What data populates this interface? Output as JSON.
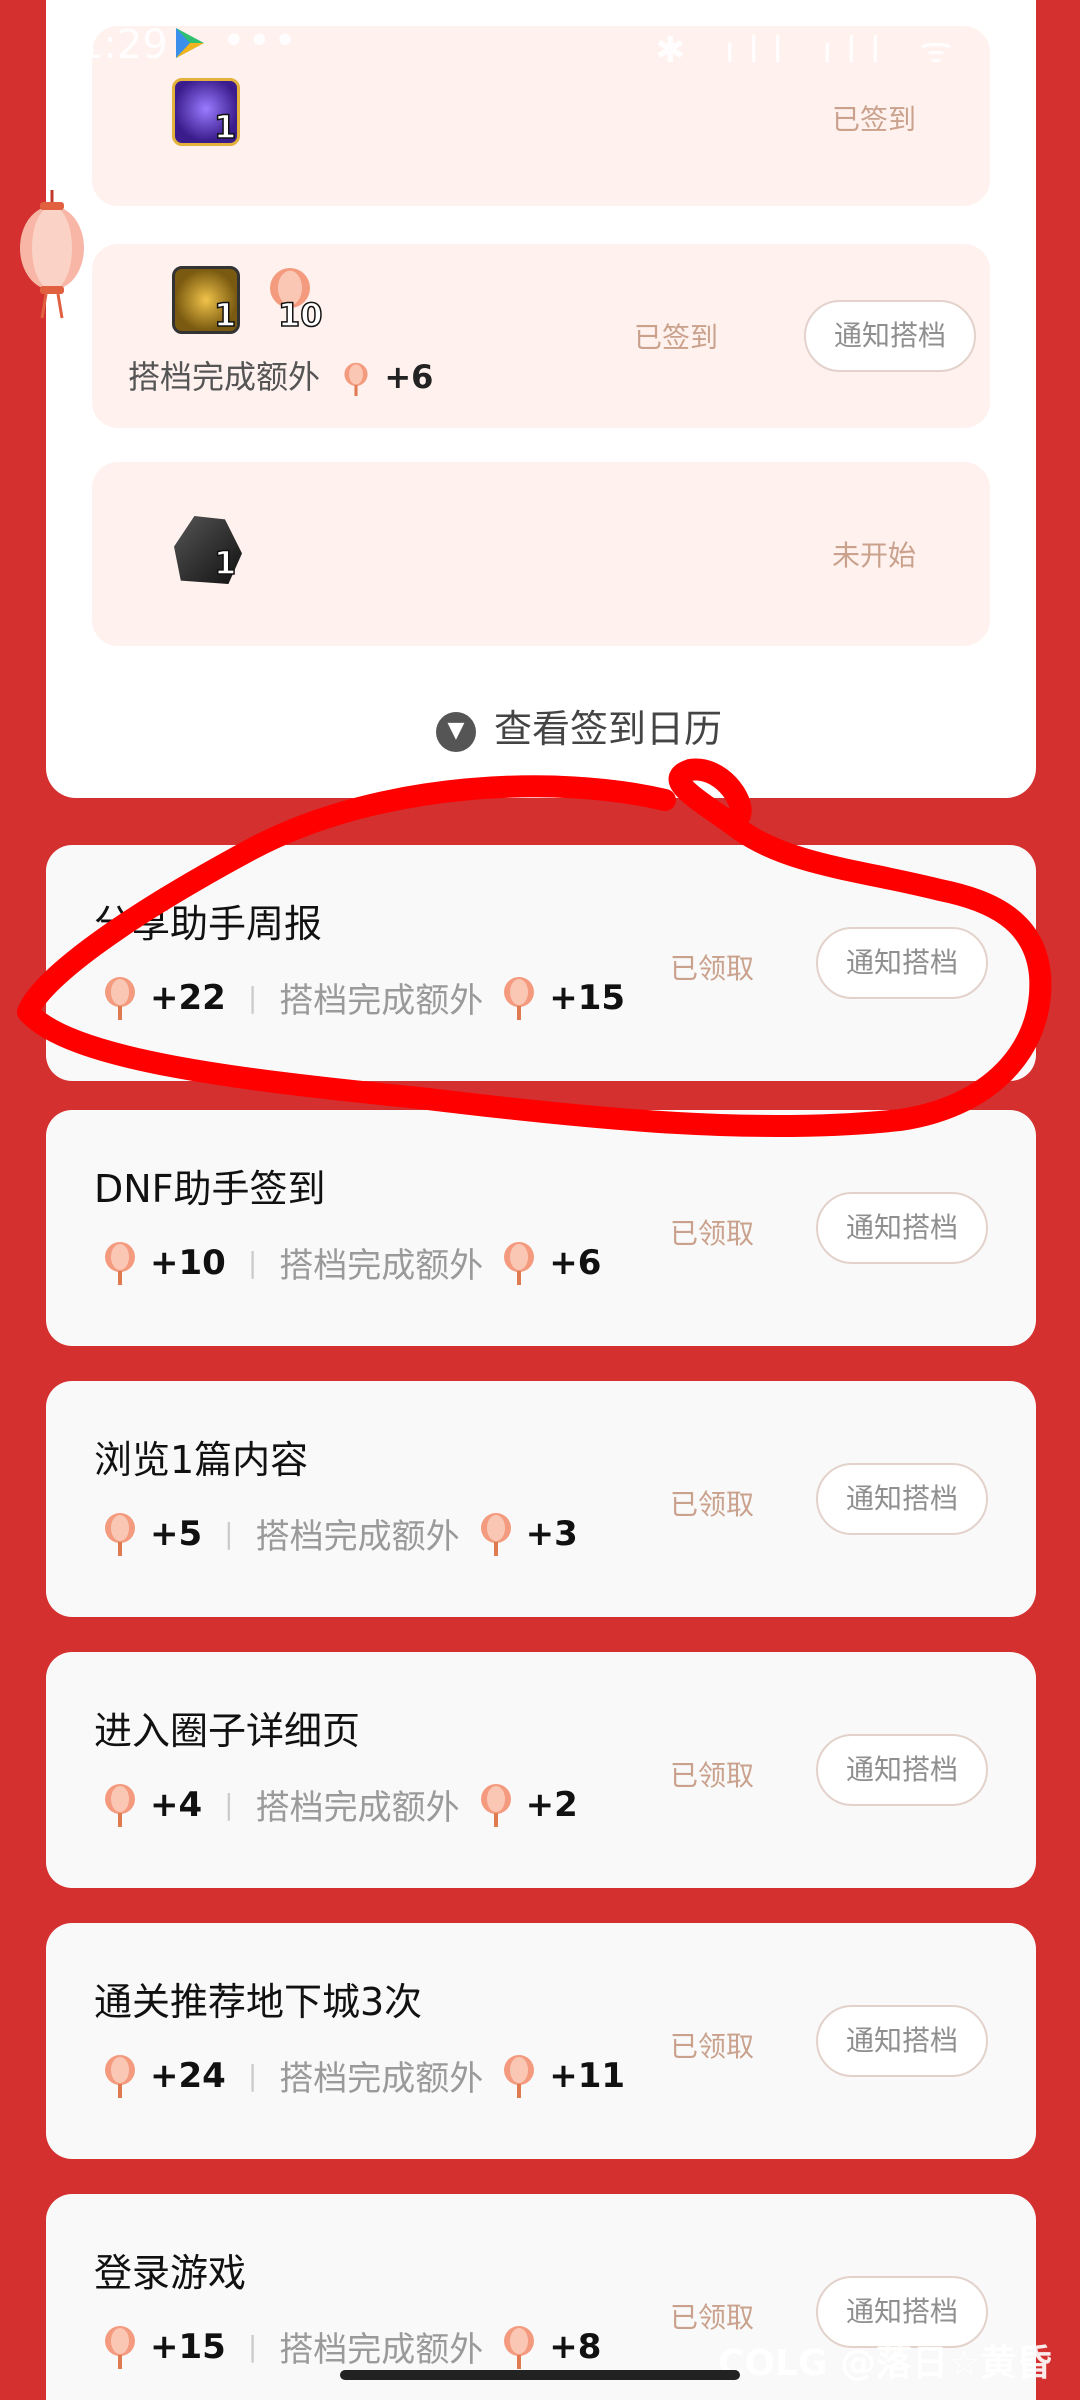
{
  "status_bar": {
    "time": "1:29",
    "dots": "•••",
    "icons": "✱ ıll ıll ᯤ ▭"
  },
  "calendar": {
    "days": [
      {
        "qty": "1",
        "status": "已签到",
        "icon_color": "#5b2fbf"
      },
      {
        "qty": "1",
        "fan_qty": "10",
        "status": "已签到",
        "extra_label": "搭档完成额外",
        "extra_value": "+6",
        "notify": "通知搭档",
        "icon_color": "#c88a1a"
      },
      {
        "qty": "1",
        "status": "未开始",
        "icon_color": "#222222"
      }
    ],
    "view_calendar": "查看签到日历"
  },
  "tasks": [
    {
      "title": "分享助手周报",
      "reward": "+22",
      "extra_label": "搭档完成额外",
      "extra_reward": "+15",
      "status": "已领取",
      "notify": "通知搭档"
    },
    {
      "title": "DNF助手签到",
      "reward": "+10",
      "extra_label": "搭档完成额外",
      "extra_reward": "+6",
      "status": "已领取",
      "notify": "通知搭档"
    },
    {
      "title": "浏览1篇内容",
      "reward": "+5",
      "extra_label": "搭档完成额外",
      "extra_reward": "+3",
      "status": "已领取",
      "notify": "通知搭档"
    },
    {
      "title": "进入圈子详细页",
      "reward": "+4",
      "extra_label": "搭档完成额外",
      "extra_reward": "+2",
      "status": "已领取",
      "notify": "通知搭档"
    },
    {
      "title": "通关推荐地下城3次",
      "reward": "+24",
      "extra_label": "搭档完成额外",
      "extra_reward": "+11",
      "status": "已领取",
      "notify": "通知搭档"
    },
    {
      "title": "登录游戏",
      "reward": "+15",
      "extra_label": "搭档完成额外",
      "extra_reward": "+8",
      "status": "已领取",
      "notify": "通知搭档"
    }
  ],
  "watermark": "COLG @落日☆黄昏",
  "colors": {
    "background": "#d3302f",
    "accent_status": "#c9a18c",
    "annotation": "#ff0000"
  }
}
